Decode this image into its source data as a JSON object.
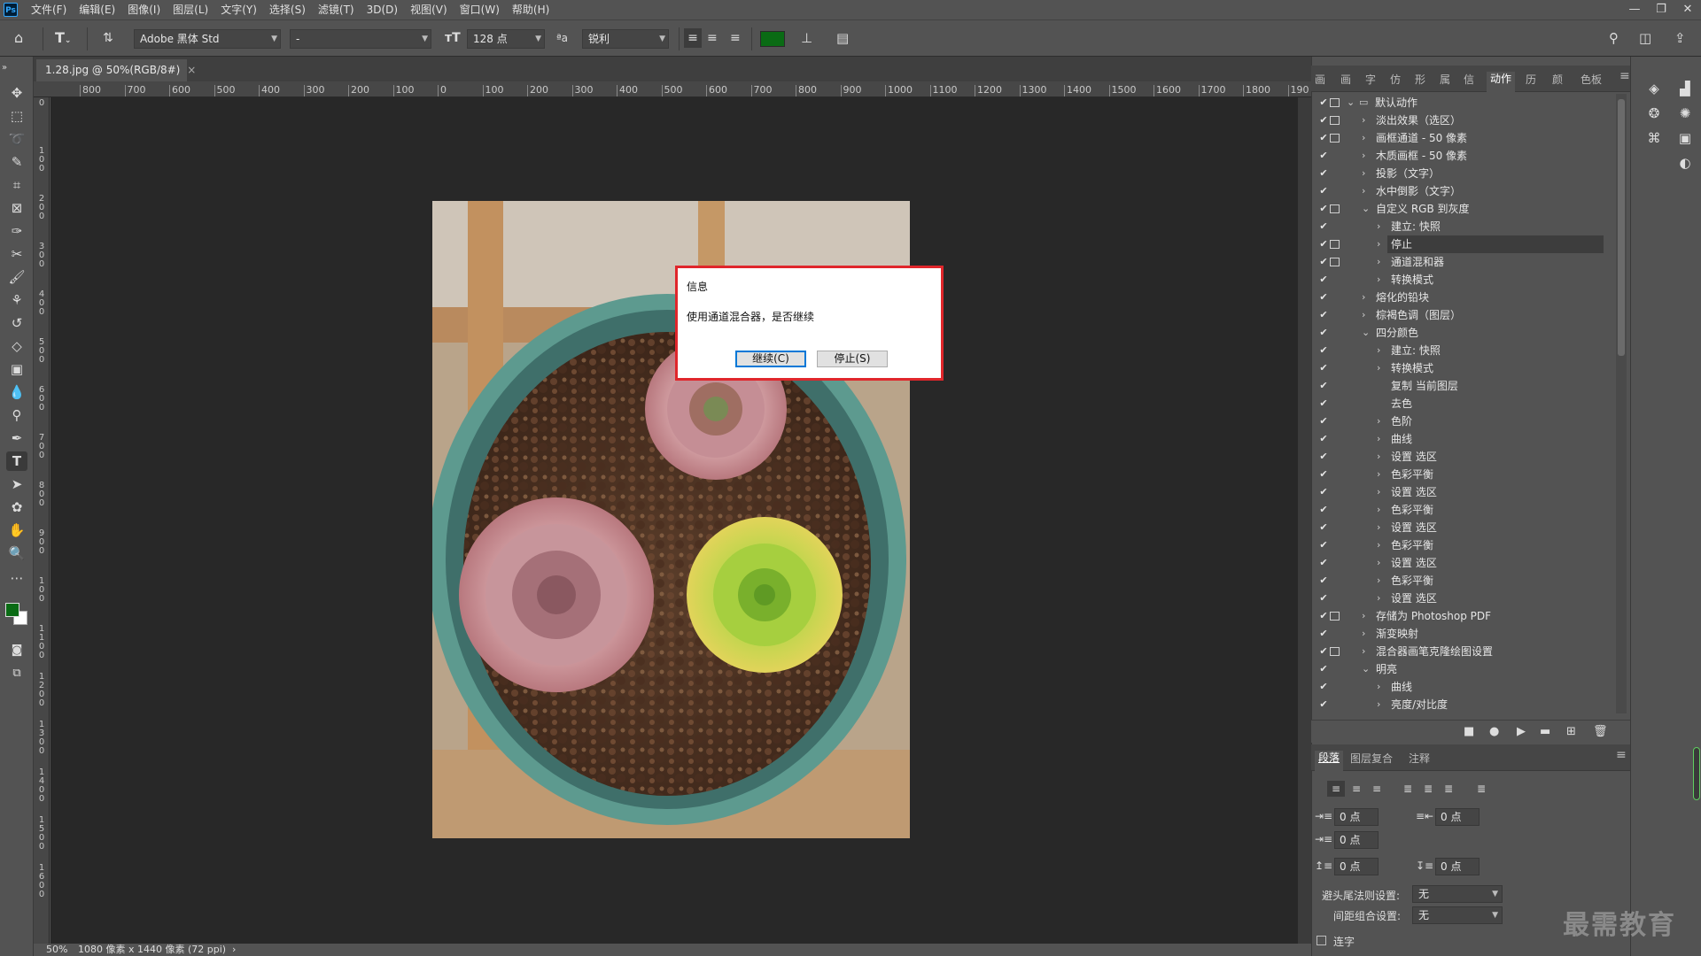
{
  "menubar": {
    "logo": "Ps",
    "items": [
      "文件(F)",
      "编辑(E)",
      "图像(I)",
      "图层(L)",
      "文字(Y)",
      "选择(S)",
      "滤镜(T)",
      "3D(D)",
      "视图(V)",
      "窗口(W)",
      "帮助(H)"
    ],
    "window_buttons": [
      "—",
      "❐",
      "✕"
    ]
  },
  "options": {
    "font_family": "Adobe 黑体 Std",
    "font_style": "-",
    "font_size": "128 点",
    "aa_label": "ªa",
    "antialias": "锐利",
    "text_color": "#0a6b14"
  },
  "document": {
    "tab_title": "1.28.jpg @ 50%(RGB/8#)",
    "tab_close": "×",
    "ruler_labels": [
      "800",
      "700",
      "600",
      "500",
      "400",
      "300",
      "200",
      "100",
      "0",
      "100",
      "200",
      "300",
      "400",
      "500",
      "600",
      "700",
      "800",
      "900",
      "1000",
      "1100",
      "1200",
      "1300",
      "1400",
      "1500",
      "1600",
      "1700",
      "1800",
      "190"
    ],
    "ruler_v_labels": [
      "0",
      "1 0 0",
      "2 0 0",
      "3 0 0",
      "4 0 0",
      "5 0 0",
      "6 0 0",
      "7 0 0",
      "8 0 0",
      "9 0 0",
      "1 0 0",
      "1 1 0 0",
      "1 2 0 0",
      "1 3 0 0",
      "1 4 0 0",
      "1 5 0 0",
      "1 6 0 0"
    ],
    "zoom": "50%",
    "size_info": "1080 像素 x 1440 像素 (72 ppi)"
  },
  "dialog": {
    "title": "信息",
    "message": "使用通道混合器，是否继续",
    "continue_label": "继续(C)",
    "stop_label": "停止(S)"
  },
  "panel_tabs": [
    "画",
    "画",
    "字",
    "仿",
    "形",
    "属",
    "信",
    "动作",
    "历",
    "颜",
    "色板"
  ],
  "actions": [
    {
      "label": "默认动作",
      "level": 0,
      "expand": "open",
      "folder": true,
      "dlg": true
    },
    {
      "label": "淡出效果（选区）",
      "level": 1,
      "expand": "closed",
      "dlg": true
    },
    {
      "label": "画框通道 - 50 像素",
      "level": 1,
      "expand": "closed",
      "dlg": true
    },
    {
      "label": "木质画框 - 50 像素",
      "level": 1,
      "expand": "closed",
      "dlg": false
    },
    {
      "label": "投影（文字）",
      "level": 1,
      "expand": "closed",
      "dlg": false
    },
    {
      "label": "水中倒影（文字）",
      "level": 1,
      "expand": "closed",
      "dlg": false
    },
    {
      "label": "自定义 RGB 到灰度",
      "level": 1,
      "expand": "open",
      "dlg": true
    },
    {
      "label": "建立: 快照",
      "level": 2,
      "expand": "closed",
      "dlg": false
    },
    {
      "label": "停止",
      "level": 2,
      "expand": "closed",
      "dlg": true,
      "selected": true
    },
    {
      "label": "通道混和器",
      "level": 2,
      "expand": "closed",
      "dlg": true
    },
    {
      "label": "转换模式",
      "level": 2,
      "expand": "closed",
      "dlg": false
    },
    {
      "label": "熔化的铅块",
      "level": 1,
      "expand": "closed",
      "dlg": false
    },
    {
      "label": "棕褐色调（图层）",
      "level": 1,
      "expand": "closed",
      "dlg": false
    },
    {
      "label": "四分颜色",
      "level": 1,
      "expand": "open",
      "dlg": false
    },
    {
      "label": "建立: 快照",
      "level": 2,
      "expand": "closed",
      "dlg": false
    },
    {
      "label": "转换模式",
      "level": 2,
      "expand": "closed",
      "dlg": false
    },
    {
      "label": "复制 当前图层",
      "level": 2,
      "expand": "none",
      "dlg": false
    },
    {
      "label": "去色",
      "level": 2,
      "expand": "none",
      "dlg": false
    },
    {
      "label": "色阶",
      "level": 2,
      "expand": "closed",
      "dlg": false
    },
    {
      "label": "曲线",
      "level": 2,
      "expand": "closed",
      "dlg": false
    },
    {
      "label": "设置 选区",
      "level": 2,
      "expand": "closed",
      "dlg": false
    },
    {
      "label": "色彩平衡",
      "level": 2,
      "expand": "closed",
      "dlg": false
    },
    {
      "label": "设置 选区",
      "level": 2,
      "expand": "closed",
      "dlg": false
    },
    {
      "label": "色彩平衡",
      "level": 2,
      "expand": "closed",
      "dlg": false
    },
    {
      "label": "设置 选区",
      "level": 2,
      "expand": "closed",
      "dlg": false
    },
    {
      "label": "色彩平衡",
      "level": 2,
      "expand": "closed",
      "dlg": false
    },
    {
      "label": "设置 选区",
      "level": 2,
      "expand": "closed",
      "dlg": false
    },
    {
      "label": "色彩平衡",
      "level": 2,
      "expand": "closed",
      "dlg": false
    },
    {
      "label": "设置 选区",
      "level": 2,
      "expand": "closed",
      "dlg": false
    },
    {
      "label": "存储为 Photoshop PDF",
      "level": 1,
      "expand": "closed",
      "dlg": true
    },
    {
      "label": "渐变映射",
      "level": 1,
      "expand": "closed",
      "dlg": false
    },
    {
      "label": "混合器画笔克隆绘图设置",
      "level": 1,
      "expand": "closed",
      "dlg": true
    },
    {
      "label": "明亮",
      "level": 1,
      "expand": "open",
      "dlg": false
    },
    {
      "label": "曲线",
      "level": 2,
      "expand": "closed",
      "dlg": false
    },
    {
      "label": "亮度/对比度",
      "level": 2,
      "expand": "closed",
      "dlg": false
    }
  ],
  "paragraph": {
    "tabs": [
      "段落",
      "图层复合",
      "注释"
    ],
    "indent_left": "0 点",
    "indent_right": "0 点",
    "indent_first": "0 点",
    "space_before": "0 点",
    "space_after": "0 点",
    "kinsoku_label": "避头尾法则设置:",
    "kinsoku_value": "无",
    "mojikumi_label": "间距组合设置:",
    "mojikumi_value": "无",
    "hyphen_label": "连字"
  },
  "watermark": "最需教育"
}
